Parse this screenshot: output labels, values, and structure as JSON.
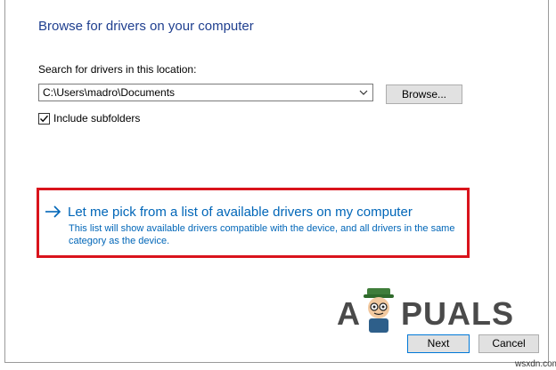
{
  "dialog": {
    "title": "Browse for drivers on your computer",
    "search_label": "Search for drivers in this location:",
    "path_value": "C:\\Users\\madro\\Documents",
    "browse_label": "Browse...",
    "include_subfolders_label": "Include subfolders",
    "include_subfolders_checked": true
  },
  "pick_option": {
    "title": "Let me pick from a list of available drivers on my computer",
    "description": "This list will show available drivers compatible with the device, and all drivers in the same category as the device."
  },
  "footer": {
    "next_label": "Next",
    "cancel_label": "Cancel"
  },
  "watermark": {
    "brand_left": "A",
    "brand_right": "PUALS",
    "site": "wsxdn.com"
  },
  "colors": {
    "title": "#1f3f8f",
    "link": "#0066b8",
    "highlight": "#d9141c",
    "button_face": "#e1e1e1",
    "focus_border": "#0078d7"
  },
  "icons": {
    "dropdown": "chevron-down-icon",
    "checkbox": "checkmark-icon",
    "link": "arrow-right-icon",
    "mascot": "mascot-logo"
  }
}
